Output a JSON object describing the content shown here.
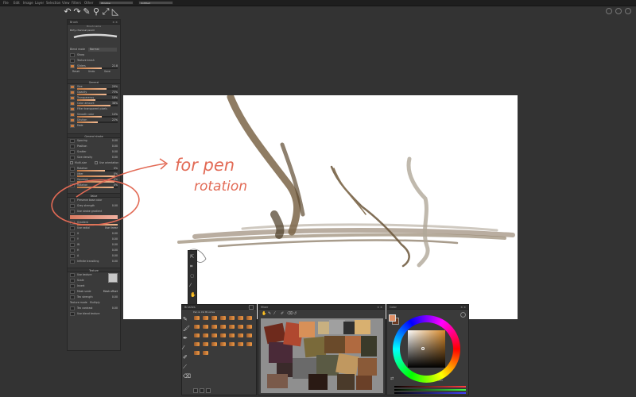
{
  "menubar": {
    "items": [
      "File",
      "Edit",
      "Image",
      "Layer",
      "Selection",
      "View",
      "Filters",
      "Other"
    ],
    "field1": "Window",
    "field2": "Untitled"
  },
  "brush_panel": {
    "title": "Brush",
    "sub_title": "Brush name",
    "brush_name": "Dirty charcoal pencil",
    "blend_mode_label": "Blend mode",
    "blend_mode_value": "Normal",
    "rows_top": [
      {
        "label": "Sharp",
        "value": ""
      },
      {
        "label": "Texture brush",
        "value": ""
      },
      {
        "label": "Sliders",
        "value": "22.8"
      }
    ],
    "actions": [
      "Reset",
      "Undo",
      "Save"
    ],
    "general_title": "General",
    "general_rows": [
      {
        "label": "Size",
        "value": "29%",
        "fill": 0.72
      },
      {
        "label": "Opacity",
        "value": "73%",
        "fill": 0.73
      },
      {
        "label": "Transparency",
        "value": "18%",
        "fill": 0.45
      },
      {
        "label": "Color amount",
        "value": "38%",
        "fill": 0.82
      },
      {
        "label": "Filter transparent pixels",
        "value": "",
        "fill": 0
      },
      {
        "label": "Smooth color",
        "value": "14%",
        "fill": 0.6
      },
      {
        "label": "Dilution",
        "value": "22%",
        "fill": 0.5
      },
      {
        "label": "Fade",
        "value": "",
        "fill": 0
      }
    ],
    "stroke_title": "General stroke",
    "stroke_rows": [
      {
        "label": "Spacing",
        "value": "0.00"
      },
      {
        "label": "Position",
        "value": "0.00"
      },
      {
        "label": "Scatter",
        "value": "0.00"
      },
      {
        "label": "Size density",
        "value": "0.00"
      }
    ],
    "stroke_checks": [
      "Multi-size",
      "Use orientation"
    ],
    "rotation_rows": [
      {
        "label": "Rotation",
        "value": "0%",
        "fill": 0.68
      },
      {
        "label": "Jitter",
        "value": "0%",
        "fill": 0.95
      },
      {
        "label": "Squeeze",
        "value": "0%",
        "fill": 0.92
      },
      {
        "label": "Rotation",
        "value": "0%",
        "fill": 0.9
      }
    ],
    "value_title": "Value",
    "value_rows": [
      {
        "label": "Preserve base color",
        "value": ""
      },
      {
        "label": "Grey strength",
        "value": "0.00"
      },
      {
        "label": "Use stroke gradient",
        "value": ""
      }
    ],
    "gradient_label": "Gradient",
    "gradient_rows": [
      {
        "label": "Use radial",
        "value": "Use linear"
      },
      {
        "label": "X",
        "value": "0.00"
      },
      {
        "label": "Y",
        "value": "0.00"
      },
      {
        "label": "W",
        "value": "0.00"
      },
      {
        "label": "H",
        "value": "0.00"
      },
      {
        "label": "A",
        "value": "0.00"
      },
      {
        "label": "Infinite transiting",
        "value": "0.00"
      }
    ],
    "texture_title": "Texture",
    "texture_rows": [
      {
        "label": "Use texture",
        "value": ""
      },
      {
        "label": "Scale",
        "value": ""
      },
      {
        "label": "Invert",
        "value": ""
      },
      {
        "label": "Mask scale",
        "value": "Mask offset"
      },
      {
        "label": "Tex strength",
        "value": "0.00"
      }
    ],
    "texture_mode_label": "Texture mode",
    "texture_mode_value": "Multiply",
    "texture_tail": [
      {
        "label": "Tex contrast",
        "value": "0.00"
      },
      {
        "label": "Use blend texture",
        "value": ""
      }
    ]
  },
  "annotation": {
    "line1": "for pen",
    "line2": "rotation",
    "color": "#e26a55"
  },
  "brushes_panel": {
    "title": "Brushes",
    "set_name": "Pen & Ink Brushes"
  },
  "mixer_panel": {
    "title": "Mixer"
  },
  "color_panel": {
    "title": "Color",
    "readouts": [
      "RGB",
      "HSV"
    ],
    "primary": "#e08f66",
    "secondary": "#6b3a22"
  },
  "canvas": {
    "background": "#ffffff"
  }
}
